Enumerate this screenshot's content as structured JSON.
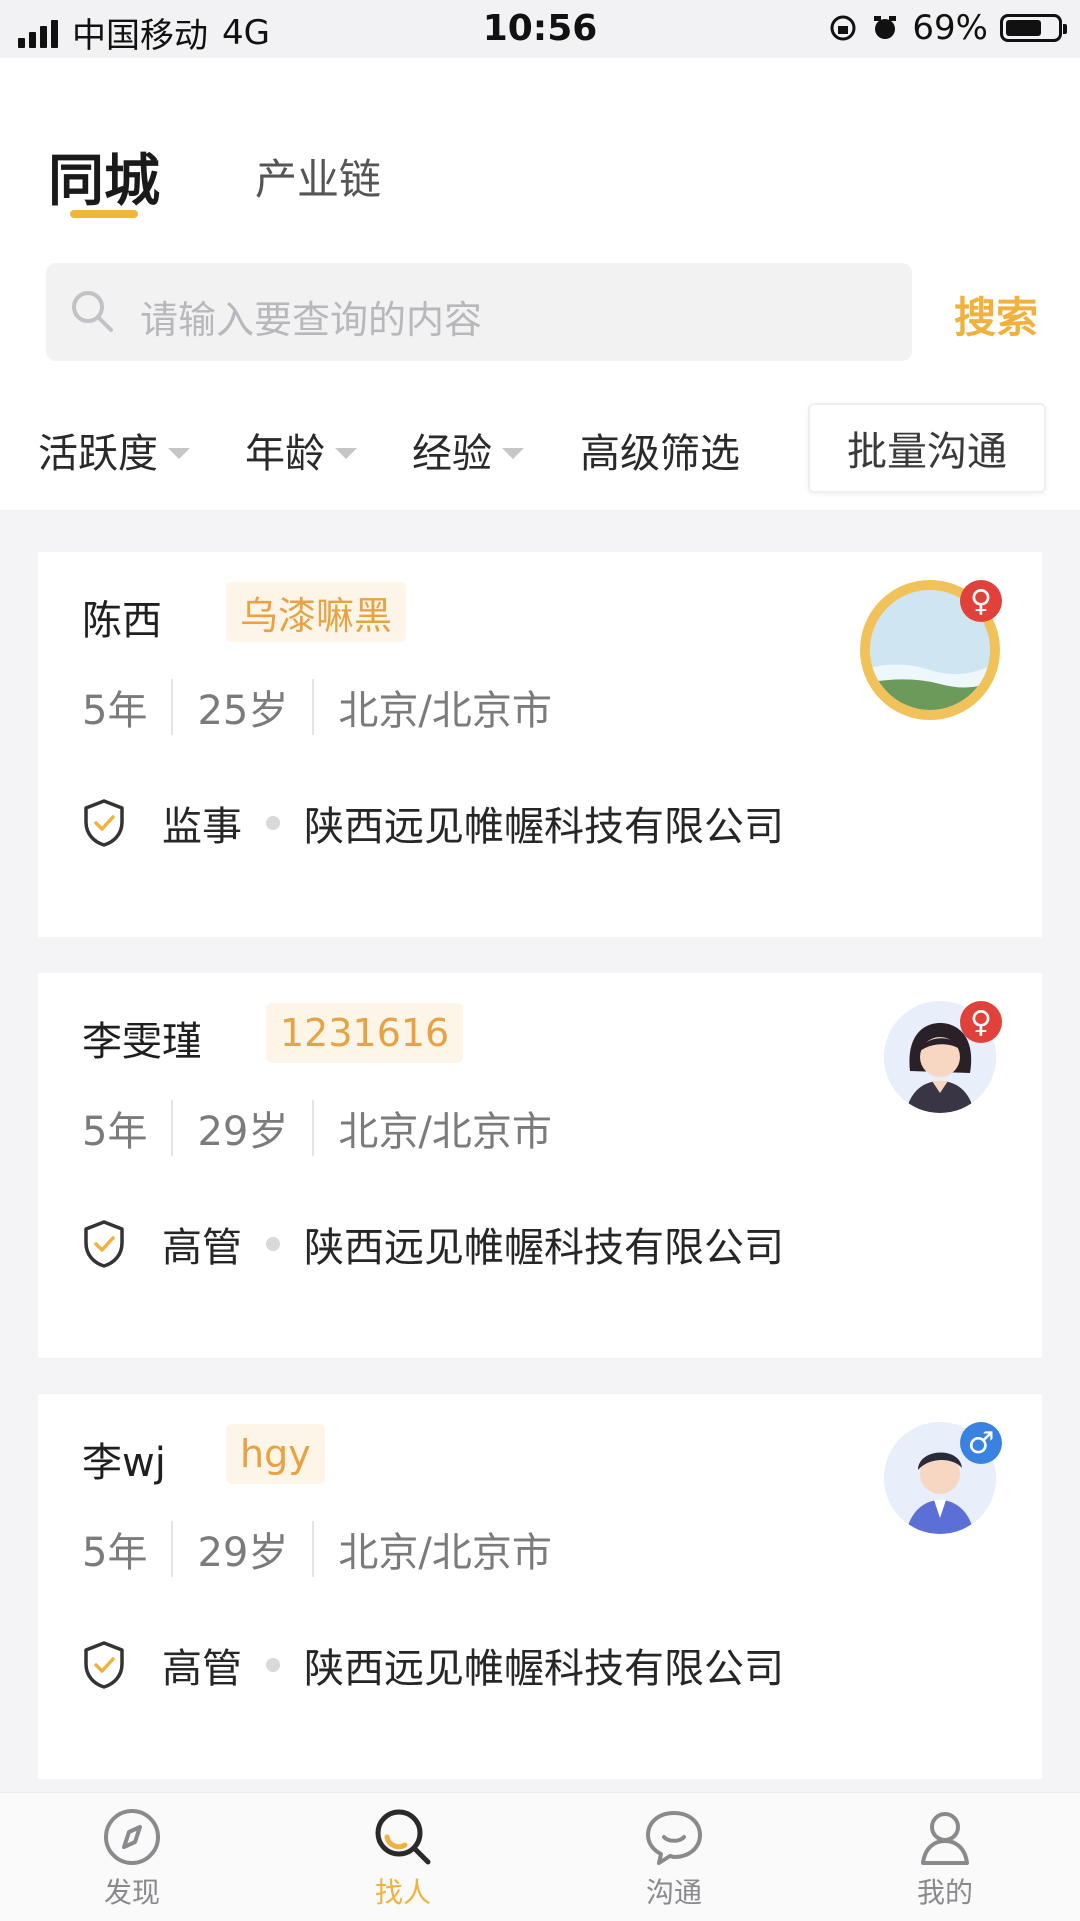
{
  "status_bar": {
    "carrier": "中国移动",
    "network": "4G",
    "time": "10:56",
    "battery": "69%",
    "battery_level": 0.69
  },
  "tabs": [
    {
      "label": "同城",
      "active": true
    },
    {
      "label": "产业链",
      "active": false
    }
  ],
  "search": {
    "placeholder": "请输入要查询的内容",
    "button": "搜索"
  },
  "filters": [
    {
      "label": "活跃度",
      "dropdown": true
    },
    {
      "label": "年龄",
      "dropdown": true
    },
    {
      "label": "经验",
      "dropdown": true
    },
    {
      "label": "高级筛选",
      "dropdown": false
    }
  ],
  "bulk_button": "批量沟通",
  "candidates": [
    {
      "name": "陈西",
      "tag": "乌漆嘛黑",
      "experience": "5年",
      "age": "25岁",
      "location": "北京/北京市",
      "role": "监事",
      "company": "陕西远见帷幄科技有限公司",
      "gender": "♀"
    },
    {
      "name": "李雯瑾",
      "tag": "1231616",
      "experience": "5年",
      "age": "29岁",
      "location": "北京/北京市",
      "role": "高管",
      "company": "陕西远见帷幄科技有限公司",
      "gender": "♀"
    },
    {
      "name": "李wj",
      "tag": "hgy",
      "experience": "5年",
      "age": "29岁",
      "location": "北京/北京市",
      "role": "高管",
      "company": "陕西远见帷幄科技有限公司",
      "gender": "♂"
    }
  ],
  "nav": [
    {
      "label": "发现",
      "icon": "compass-icon",
      "active": false
    },
    {
      "label": "找人",
      "icon": "search-person-icon",
      "active": true
    },
    {
      "label": "沟通",
      "icon": "chat-icon",
      "active": false
    },
    {
      "label": "我的",
      "icon": "user-icon",
      "active": false
    }
  ],
  "colors": {
    "accent": "#f0b23c",
    "tag_bg": "#fdf5e8",
    "female": "#e0413a",
    "male": "#3a82e0"
  }
}
